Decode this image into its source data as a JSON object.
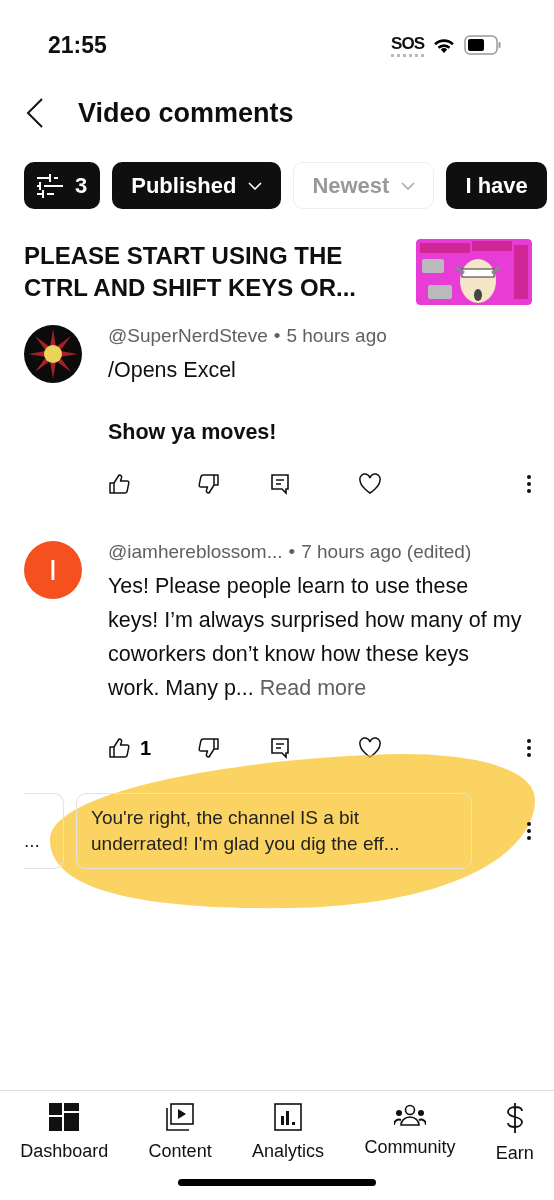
{
  "status_bar": {
    "time": "21:55",
    "sos": "SOS"
  },
  "header": {
    "title": "Video comments"
  },
  "chips": [
    {
      "kind": "filter",
      "label": "3",
      "active": true
    },
    {
      "kind": "dropdown",
      "label": "Published",
      "active": true
    },
    {
      "kind": "dropdown",
      "label": "Newest",
      "active": false
    },
    {
      "kind": "plain",
      "label": "I have",
      "active": true
    }
  ],
  "video": {
    "title": "PLEASE START USING THE CTRL AND SHIFT KEYS OR..."
  },
  "comments": [
    {
      "avatar": {
        "kind": "emblem"
      },
      "handle": "@SuperNerdSteve",
      "time": "5 hours ago",
      "separator": "•",
      "paragraphs": [
        "/Opens Excel",
        "**Show ya moves!**"
      ]
    },
    {
      "avatar": {
        "kind": "letter",
        "letter": "I",
        "color": "#f4511e"
      },
      "handle": "@iamhereblossom...",
      "separator": "•",
      "time": "7 hours ago (edited)",
      "paragraphs": [
        "Yes! Please people learn to use these keys! I’m always surprised how many of my coworkers don’t know how these keys work. Many p..."
      ],
      "read_more": "Read more",
      "likes": "1"
    }
  ],
  "replies": {
    "cards": [
      {
        "text": "..."
      },
      {
        "text": "You're right, the channel IS a bit underrated! I'm glad you dig the eff..."
      }
    ],
    "highlighted": true
  },
  "nav": [
    {
      "kind": "dashboard",
      "label": "Dashboard"
    },
    {
      "kind": "content",
      "label": "Content"
    },
    {
      "kind": "analytics",
      "label": "Analytics"
    },
    {
      "kind": "community",
      "label": "Community"
    },
    {
      "kind": "earn",
      "label": "Earn"
    }
  ]
}
